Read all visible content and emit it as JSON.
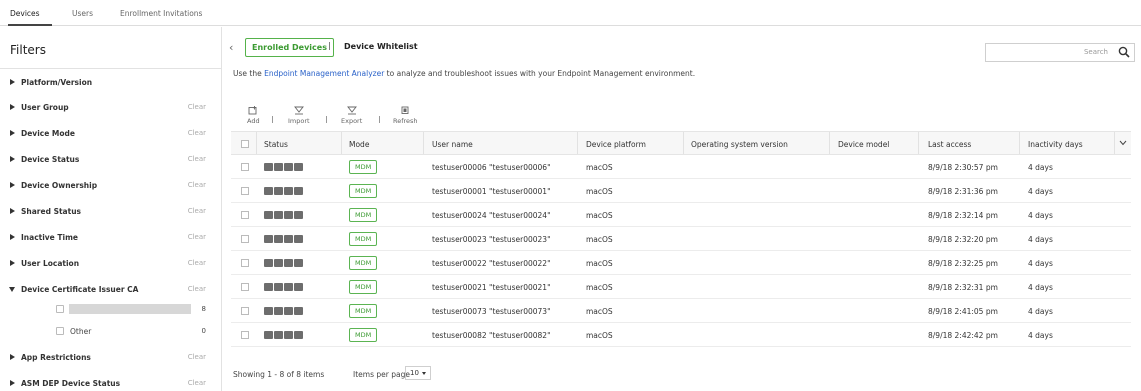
{
  "top_tabs": [
    {
      "label": "Devices"
    },
    {
      "label": "Users"
    },
    {
      "label": "Enrollment Invitations"
    }
  ],
  "filters": {
    "title": "Filters",
    "clear_label": "Clear",
    "items": [
      {
        "label": "Platform/Version",
        "clear": ""
      },
      {
        "label": "User Group",
        "clear": "Clear"
      },
      {
        "label": "Device Mode",
        "clear": "Clear"
      },
      {
        "label": "Device Status",
        "clear": "Clear"
      },
      {
        "label": "Device Ownership",
        "clear": "Clear"
      },
      {
        "label": "Shared Status",
        "clear": "Clear"
      },
      {
        "label": "Inactive Time",
        "clear": "Clear"
      },
      {
        "label": "User Location",
        "clear": "Clear"
      },
      {
        "label": "Device Certificate Issuer CA",
        "clear": "Clear"
      },
      {
        "label": "App Restrictions",
        "clear": "Clear"
      },
      {
        "label": "ASM DEP Device Status",
        "clear": "Clear"
      }
    ],
    "cert_sub": [
      {
        "label": "",
        "count": "8"
      },
      {
        "label": "Other",
        "count": "0"
      }
    ]
  },
  "main": {
    "tab_active": "Enrolled Devices",
    "tab_sep": "|",
    "tab_other": "Device Whitelist",
    "search_placeholder": "Search",
    "info_prefix": "Use the ",
    "info_link": "Endpoint Management Analyzer",
    "info_suffix": " to analyze and troubleshoot issues with your Endpoint Management environment.",
    "toolbar": {
      "add": "Add",
      "import": "Import",
      "export": "Export",
      "refresh": "Refresh"
    }
  },
  "table": {
    "headers": {
      "status": "Status",
      "mode": "Mode",
      "user": "User name",
      "platform": "Device platform",
      "os": "Operating system version",
      "model": "Device model",
      "last": "Last access",
      "inactivity": "Inactivity days"
    },
    "rows": [
      {
        "mode": "MDM",
        "user": "testuser00006 \"testuser00006\"",
        "platform": "macOS",
        "last": "8/9/18 2:30:57 pm",
        "inactivity": "4 days"
      },
      {
        "mode": "MDM",
        "user": "testuser00001 \"testuser00001\"",
        "platform": "macOS",
        "last": "8/9/18 2:31:36 pm",
        "inactivity": "4 days"
      },
      {
        "mode": "MDM",
        "user": "testuser00024 \"testuser00024\"",
        "platform": "macOS",
        "last": "8/9/18 2:32:14 pm",
        "inactivity": "4 days"
      },
      {
        "mode": "MDM",
        "user": "testuser00023 \"testuser00023\"",
        "platform": "macOS",
        "last": "8/9/18 2:32:20 pm",
        "inactivity": "4 days"
      },
      {
        "mode": "MDM",
        "user": "testuser00022 \"testuser00022\"",
        "platform": "macOS",
        "last": "8/9/18 2:32:25 pm",
        "inactivity": "4 days"
      },
      {
        "mode": "MDM",
        "user": "testuser00021 \"testuser00021\"",
        "platform": "macOS",
        "last": "8/9/18 2:32:31 pm",
        "inactivity": "4 days"
      },
      {
        "mode": "MDM",
        "user": "testuser00073 \"testuser00073\"",
        "platform": "macOS",
        "last": "8/9/18 2:41:05 pm",
        "inactivity": "4 days"
      },
      {
        "mode": "MDM",
        "user": "testuser00082 \"testuser00082\"",
        "platform": "macOS",
        "last": "8/9/18 2:42:42 pm",
        "inactivity": "4 days"
      }
    ]
  },
  "footer": {
    "showing": "Showing 1 - 8 of 8 items",
    "items_per_page": "Items per page",
    "page_size": "10"
  },
  "colors": {
    "accent_green": "#3b9a31",
    "link_blue": "#2a62c9"
  }
}
